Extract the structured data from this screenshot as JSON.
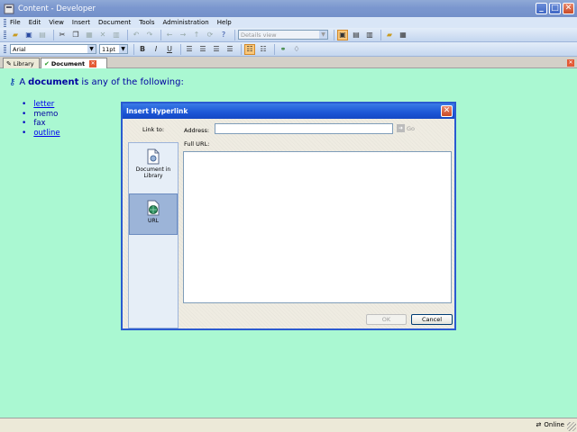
{
  "window": {
    "title": "Content - Developer"
  },
  "menubar": {
    "items": [
      {
        "label": "File"
      },
      {
        "label": "Edit"
      },
      {
        "label": "View"
      },
      {
        "label": "Insert"
      },
      {
        "label": "Document"
      },
      {
        "label": "Tools"
      },
      {
        "label": "Administration"
      },
      {
        "label": "Help"
      }
    ]
  },
  "toolbar1": {
    "view_combo": "Details view"
  },
  "toolbar2": {
    "font": "Arial",
    "size": "11pt",
    "bold": "B",
    "italic": "I",
    "underline": "U"
  },
  "tabs": [
    {
      "label": "Library"
    },
    {
      "label": "Document"
    }
  ],
  "document": {
    "intro_prefix": "A",
    "intro_bold": "document",
    "intro_suffix": "is any of the following:",
    "items": [
      {
        "text": "letter",
        "link": true
      },
      {
        "text": "memo",
        "link": false
      },
      {
        "text": "fax",
        "link": false
      },
      {
        "text": "outline",
        "link": true
      }
    ]
  },
  "dialog": {
    "title": "Insert Hyperlink",
    "link_to_label": "Link to:",
    "link_types": [
      {
        "label": "Document in Library",
        "line1": "Document in",
        "line2": "Library"
      },
      {
        "label": "URL"
      }
    ],
    "address_label": "Address:",
    "address_value": "",
    "go_label": "Go",
    "full_url_label": "Full URL:",
    "ok_label": "OK",
    "cancel_label": "Cancel"
  },
  "status": {
    "online_label": "Online"
  },
  "colors": {
    "document_bg": "#aaf8d2",
    "dialog_title": "#1c56d6",
    "link": "#0000ee"
  }
}
